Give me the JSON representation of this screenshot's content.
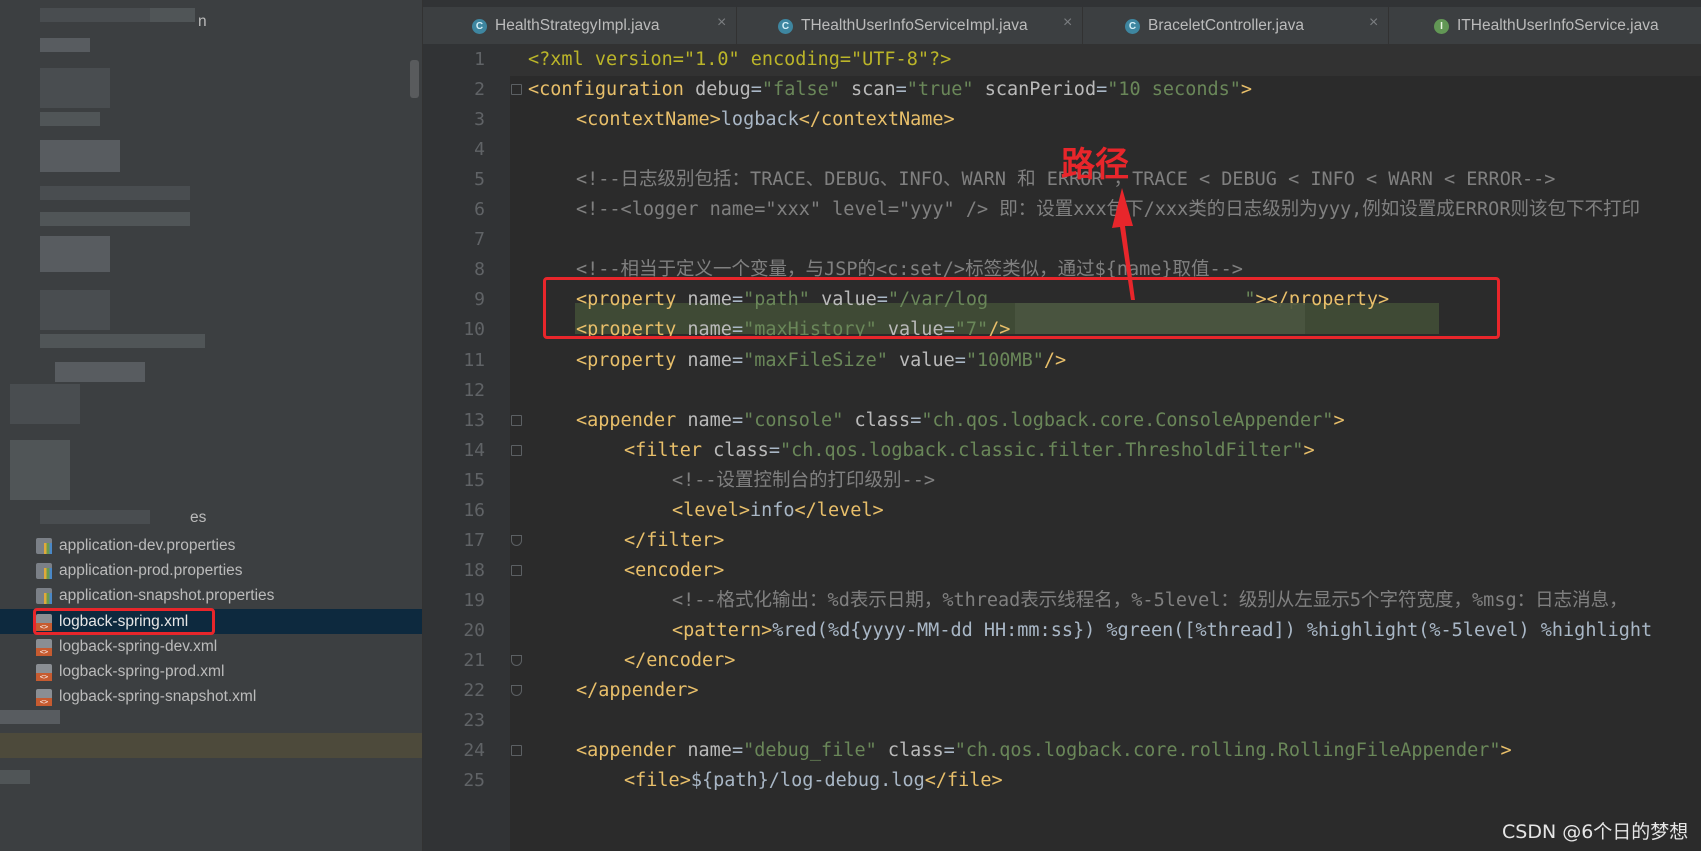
{
  "project_tree": {
    "partial_label_top": "n",
    "partial_label_resources": "es",
    "files": [
      {
        "name": "application-dev.properties",
        "type": "properties"
      },
      {
        "name": "application-prod.properties",
        "type": "properties"
      },
      {
        "name": "application-snapshot.properties",
        "type": "properties"
      },
      {
        "name": "logback-spring.xml",
        "type": "xml",
        "selected": true
      },
      {
        "name": "logback-spring-dev.xml",
        "type": "xml"
      },
      {
        "name": "logback-spring-prod.xml",
        "type": "xml"
      },
      {
        "name": "logback-spring-snapshot.xml",
        "type": "xml"
      }
    ]
  },
  "tabs": [
    {
      "label": "HealthStrategyImpl.java",
      "icon": "class-icon",
      "icon_letter": "C",
      "close": "×"
    },
    {
      "label": "THealthUserInfoServiceImpl.java",
      "icon": "class-icon",
      "icon_letter": "C",
      "close": "×"
    },
    {
      "label": "BraceletController.java",
      "icon": "class-icon",
      "icon_letter": "C",
      "close": "×"
    },
    {
      "label": "ITHealthUserInfoService.java",
      "icon": "interface-icon",
      "icon_letter": "I",
      "close": ""
    }
  ],
  "editor": {
    "lines": [
      {
        "n": "1",
        "indent": 0,
        "tokens": [
          [
            "pi",
            "<?xml version=\"1.0\" encoding=\"UTF-8\"?>"
          ]
        ]
      },
      {
        "n": "2",
        "indent": 0,
        "tokens": [
          [
            "tag",
            "<configuration "
          ],
          [
            "attr",
            "debug"
          ],
          [
            "txt",
            "="
          ],
          [
            "val",
            "\"false\" "
          ],
          [
            "attr",
            "scan"
          ],
          [
            "txt",
            "="
          ],
          [
            "val",
            "\"true\" "
          ],
          [
            "attr",
            "scanPeriod"
          ],
          [
            "txt",
            "="
          ],
          [
            "val",
            "\"10 seconds\""
          ],
          [
            "tag",
            ">"
          ]
        ]
      },
      {
        "n": "3",
        "indent": 1,
        "tokens": [
          [
            "tag",
            "<contextName>"
          ],
          [
            "txt",
            "logback"
          ],
          [
            "tag",
            "</contextName>"
          ]
        ]
      },
      {
        "n": "4",
        "indent": 0,
        "tokens": []
      },
      {
        "n": "5",
        "indent": 1,
        "tokens": [
          [
            "cmt",
            "<!--日志级别包括：TRACE、DEBUG、INFO、WARN 和 ERROR ，TRACE < DEBUG < INFO < WARN < ERROR-->"
          ]
        ]
      },
      {
        "n": "6",
        "indent": 1,
        "tokens": [
          [
            "cmt",
            "<!--<logger name=\"xxx\" level=\"yyy\" /> 即：设置xxx包下/xxx类的日志级别为yyy,例如设置成ERROR则该包下不打印"
          ]
        ]
      },
      {
        "n": "7",
        "indent": 0,
        "tokens": []
      },
      {
        "n": "8",
        "indent": 1,
        "tokens": [
          [
            "cmt",
            "<!--相当于定义一个变量，与JSP的<c:set/>标签类似，通过${name}取值-->"
          ]
        ]
      },
      {
        "n": "9",
        "indent": 1,
        "tokens": [
          [
            "tag",
            "<property "
          ],
          [
            "attr",
            "name"
          ],
          [
            "txt",
            "="
          ],
          [
            "val",
            "\"path\" "
          ],
          [
            "attr",
            "value"
          ],
          [
            "txt",
            "="
          ],
          [
            "val",
            "\"/var/log                       \""
          ],
          [
            "tag",
            "></property>"
          ]
        ]
      },
      {
        "n": "10",
        "indent": 1,
        "tokens": [
          [
            "tag",
            "<property "
          ],
          [
            "attr",
            "name"
          ],
          [
            "txt",
            "="
          ],
          [
            "val",
            "\"maxHistory\" "
          ],
          [
            "attr",
            "value"
          ],
          [
            "txt",
            "="
          ],
          [
            "val",
            "\"7\""
          ],
          [
            "tag",
            "/>"
          ]
        ]
      },
      {
        "n": "11",
        "indent": 1,
        "tokens": [
          [
            "tag",
            "<property "
          ],
          [
            "attr",
            "name"
          ],
          [
            "txt",
            "="
          ],
          [
            "val",
            "\"maxFileSize\" "
          ],
          [
            "attr",
            "value"
          ],
          [
            "txt",
            "="
          ],
          [
            "val",
            "\"100MB\""
          ],
          [
            "tag",
            "/>"
          ]
        ]
      },
      {
        "n": "12",
        "indent": 0,
        "tokens": []
      },
      {
        "n": "13",
        "indent": 1,
        "tokens": [
          [
            "tag",
            "<appender "
          ],
          [
            "attr",
            "name"
          ],
          [
            "txt",
            "="
          ],
          [
            "val",
            "\"console\" "
          ],
          [
            "attr",
            "class"
          ],
          [
            "txt",
            "="
          ],
          [
            "val",
            "\"ch.qos.logback.core.ConsoleAppender\""
          ],
          [
            "tag",
            ">"
          ]
        ]
      },
      {
        "n": "14",
        "indent": 2,
        "tokens": [
          [
            "tag",
            "<filter "
          ],
          [
            "attr",
            "class"
          ],
          [
            "txt",
            "="
          ],
          [
            "val",
            "\"ch.qos.logback.classic.filter.ThresholdFilter\""
          ],
          [
            "tag",
            ">"
          ]
        ]
      },
      {
        "n": "15",
        "indent": 3,
        "tokens": [
          [
            "cmt",
            "<!--设置控制台的打印级别-->"
          ]
        ]
      },
      {
        "n": "16",
        "indent": 3,
        "tokens": [
          [
            "tag",
            "<level>"
          ],
          [
            "txt",
            "info"
          ],
          [
            "tag",
            "</level>"
          ]
        ]
      },
      {
        "n": "17",
        "indent": 2,
        "tokens": [
          [
            "tag",
            "</filter>"
          ]
        ]
      },
      {
        "n": "18",
        "indent": 2,
        "tokens": [
          [
            "tag",
            "<encoder>"
          ]
        ]
      },
      {
        "n": "19",
        "indent": 3,
        "tokens": [
          [
            "cmt",
            "<!--格式化输出：%d表示日期，%thread表示线程名，%-5level：级别从左显示5个字符宽度，%msg：日志消息，"
          ]
        ]
      },
      {
        "n": "20",
        "indent": 3,
        "tokens": [
          [
            "tag",
            "<pattern>"
          ],
          [
            "txt",
            "%red(%d{yyyy-MM-dd HH:mm:ss}) %green([%thread]) %highlight(%-5level) %highlight"
          ]
        ]
      },
      {
        "n": "21",
        "indent": 2,
        "tokens": [
          [
            "tag",
            "</encoder>"
          ]
        ]
      },
      {
        "n": "22",
        "indent": 1,
        "tokens": [
          [
            "tag",
            "</appender>"
          ]
        ]
      },
      {
        "n": "23",
        "indent": 0,
        "tokens": []
      },
      {
        "n": "24",
        "indent": 1,
        "tokens": [
          [
            "tag",
            "<appender "
          ],
          [
            "attr",
            "name"
          ],
          [
            "txt",
            "="
          ],
          [
            "val",
            "\"debug_file\" "
          ],
          [
            "attr",
            "class"
          ],
          [
            "txt",
            "="
          ],
          [
            "val",
            "\"ch.qos.logback.core.rolling.RollingFileAppender\""
          ],
          [
            "tag",
            ">"
          ]
        ]
      },
      {
        "n": "25",
        "indent": 2,
        "tokens": [
          [
            "tag",
            "<file>"
          ],
          [
            "txt",
            "${path}/log-debug.log"
          ],
          [
            "tag",
            "</file>"
          ]
        ]
      }
    ]
  },
  "annotation": {
    "label": "路径",
    "color": "#e8262b"
  },
  "watermark": "CSDN @6个日的梦想",
  "colors": {
    "tag": "#e8bf6a",
    "attr": "#bababa",
    "value": "#6a8759",
    "comment": "#808080",
    "text": "#a9b7c6",
    "highlight_box": "#e8262b",
    "selection": "#0d293e"
  }
}
